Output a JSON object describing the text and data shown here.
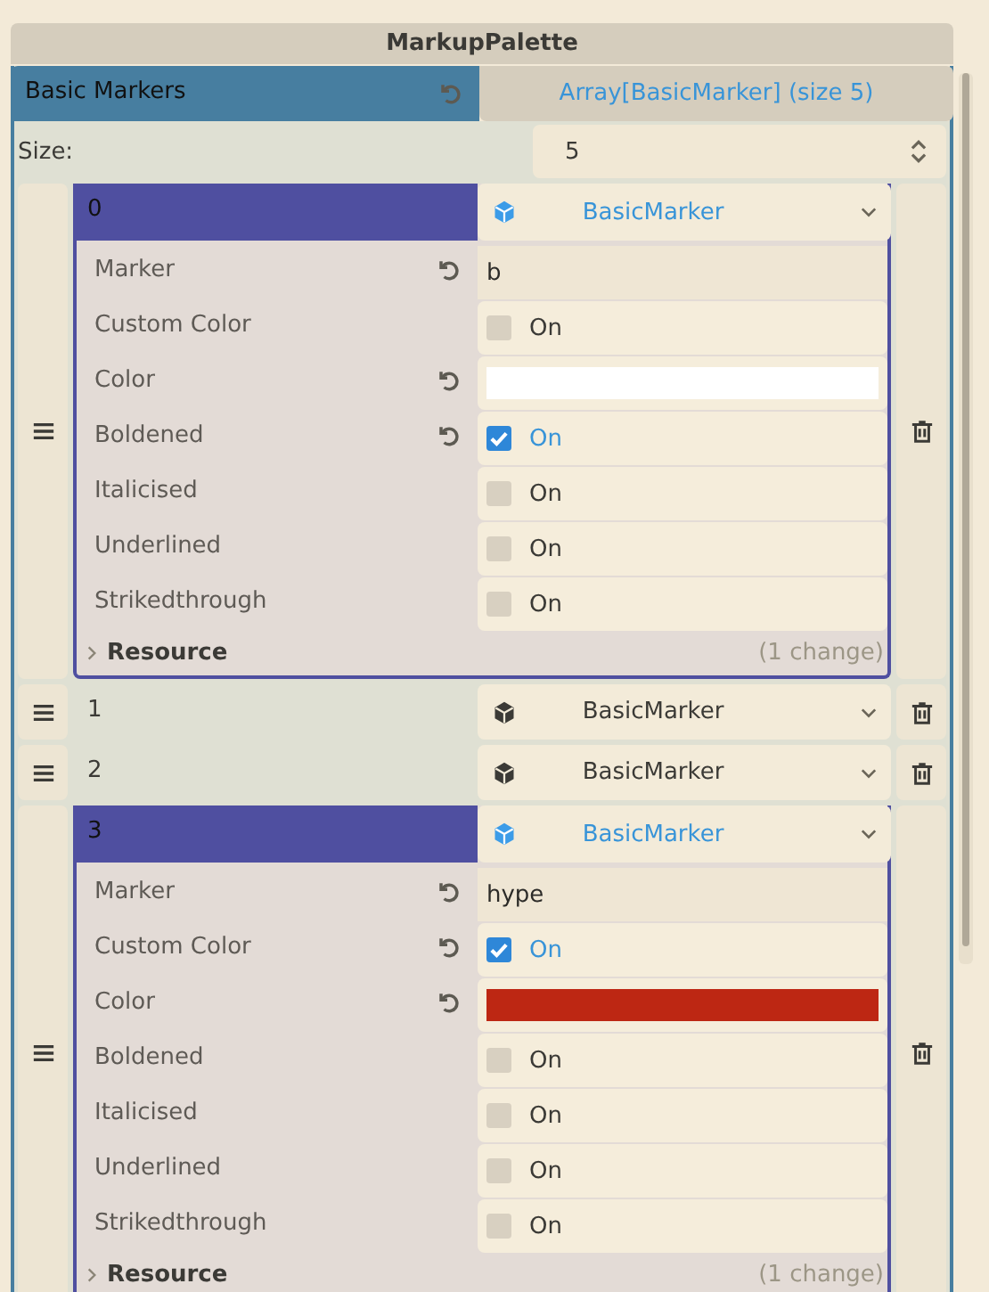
{
  "title": "MarkupPalette",
  "property": {
    "label": "Basic Markers",
    "modified": true,
    "value": "Array[BasicMarker] (size 5)"
  },
  "size": {
    "label": "Size:",
    "value": "5"
  },
  "elements": [
    {
      "index": "0",
      "expanded": true,
      "type_label": "BasicMarker",
      "properties": [
        {
          "label": "Marker",
          "kind": "text",
          "modified": true,
          "value": "b"
        },
        {
          "label": "Custom Color",
          "kind": "check",
          "modified": false,
          "checked": false,
          "value": "On"
        },
        {
          "label": "Color",
          "kind": "color",
          "modified": true,
          "color": "#ffffff"
        },
        {
          "label": "Boldened",
          "kind": "check",
          "modified": true,
          "checked": true,
          "value": "On"
        },
        {
          "label": "Italicised",
          "kind": "check",
          "modified": false,
          "checked": false,
          "value": "On"
        },
        {
          "label": "Underlined",
          "kind": "check",
          "modified": false,
          "checked": false,
          "value": "On"
        },
        {
          "label": "Strikedthrough",
          "kind": "check",
          "modified": false,
          "checked": false,
          "value": "On"
        }
      ],
      "resource": {
        "label": "Resource",
        "note": "(1 change)"
      }
    },
    {
      "index": "1",
      "expanded": false,
      "type_label": "BasicMarker"
    },
    {
      "index": "2",
      "expanded": false,
      "type_label": "BasicMarker"
    },
    {
      "index": "3",
      "expanded": true,
      "type_label": "BasicMarker",
      "properties": [
        {
          "label": "Marker",
          "kind": "text",
          "modified": true,
          "value": "hype"
        },
        {
          "label": "Custom Color",
          "kind": "check",
          "modified": true,
          "checked": true,
          "value": "On"
        },
        {
          "label": "Color",
          "kind": "color",
          "modified": true,
          "color": "#bd2713"
        },
        {
          "label": "Boldened",
          "kind": "check",
          "modified": false,
          "checked": false,
          "value": "On"
        },
        {
          "label": "Italicised",
          "kind": "check",
          "modified": false,
          "checked": false,
          "value": "On"
        },
        {
          "label": "Underlined",
          "kind": "check",
          "modified": false,
          "checked": false,
          "value": "On"
        },
        {
          "label": "Strikedthrough",
          "kind": "check",
          "modified": false,
          "checked": false,
          "value": "On"
        }
      ],
      "resource": {
        "label": "Resource",
        "note": "(1 change)"
      }
    }
  ]
}
